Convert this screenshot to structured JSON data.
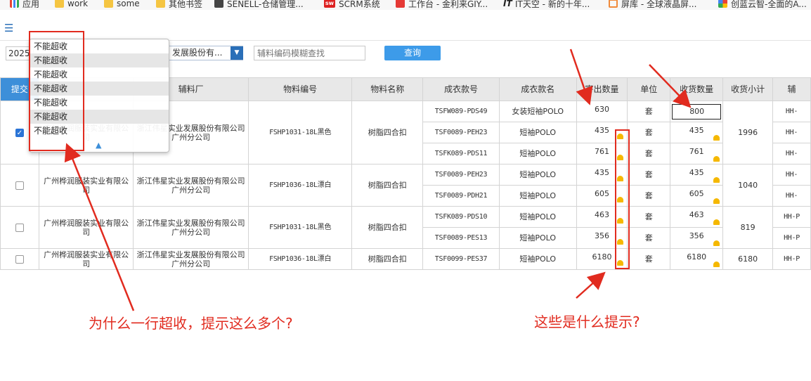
{
  "bookmarks": [
    {
      "label": "应用",
      "icon": "apps-grid-icon"
    },
    {
      "label": "work",
      "icon": "folder-icon"
    },
    {
      "label": "some",
      "icon": "folder-icon"
    },
    {
      "label": "其他书签",
      "icon": "folder-icon"
    },
    {
      "label": "SENELL-仓储管理...",
      "icon": "senell-icon"
    },
    {
      "label": "SCRM系统",
      "icon": "sw-icon"
    },
    {
      "label": "工作台 - 金利来GIY...",
      "icon": "red-square-icon"
    },
    {
      "label": "IT天空 - 新的十年...",
      "icon": "it-icon"
    },
    {
      "label": "屏库 - 全球液晶屏...",
      "icon": "orange-circle-icon"
    },
    {
      "label": "创蓝云智-全面的A...",
      "icon": "multicolor-icon"
    }
  ],
  "toolbar": {
    "year_value": "2025",
    "supplier_value": "发展股份有...",
    "search_placeholder": "辅料编码模糊查找",
    "query_label": "查询"
  },
  "dropdown": {
    "items": [
      "不能超收",
      "不能超收",
      "不能超收",
      "不能超收",
      "不能超收",
      "不能超收",
      "不能超收"
    ]
  },
  "table": {
    "headers": [
      "提交",
      "",
      "辅料厂",
      "物料编号",
      "物料名称",
      "成衣款号",
      "成衣款名",
      "寄出数量",
      "单位",
      "收货数量",
      "收货小计",
      "辅"
    ],
    "groups": [
      {
        "checked": true,
        "factory": "广州桦润服装实业有限公司",
        "supplier": "浙江伟星实业发展股份有限公司广州分公司",
        "material_no": "FSHP1031-18L黑色",
        "material_name": "树脂四合扣",
        "subtotal": "1996",
        "rows": [
          {
            "style_no": "TSFW089-PDS49",
            "style_name": "女装短袖POLO",
            "sent": "630",
            "unit": "套",
            "received": "800",
            "sent_warn": false,
            "recv_warn": false,
            "editing": true,
            "extra": "HH-"
          },
          {
            "style_no": "TSF0089-PEH23",
            "style_name": "短袖POLO",
            "sent": "435",
            "unit": "套",
            "received": "435",
            "sent_warn": true,
            "recv_warn": true,
            "editing": false,
            "extra": "HH-"
          },
          {
            "style_no": "TSFK089-PDS11",
            "style_name": "短袖POLO",
            "sent": "761",
            "unit": "套",
            "received": "761",
            "sent_warn": true,
            "recv_warn": true,
            "editing": false,
            "extra": "HH-"
          }
        ]
      },
      {
        "checked": false,
        "factory": "广州桦润服装实业有限公司",
        "supplier": "浙江伟星实业发展股份有限公司广州分公司",
        "material_no": "FSHP1036-18L漂白",
        "material_name": "树脂四合扣",
        "subtotal": "1040",
        "rows": [
          {
            "style_no": "TSF0089-PEH23",
            "style_name": "短袖POLO",
            "sent": "435",
            "unit": "套",
            "received": "435",
            "sent_warn": true,
            "recv_warn": true,
            "editing": false,
            "extra": "HH-"
          },
          {
            "style_no": "TSF0089-PDH21",
            "style_name": "短袖POLO",
            "sent": "605",
            "unit": "套",
            "received": "605",
            "sent_warn": true,
            "recv_warn": true,
            "editing": false,
            "extra": "HH-"
          }
        ]
      },
      {
        "checked": false,
        "factory": "广州桦润服装实业有限公司",
        "supplier": "浙江伟星实业发展股份有限公司广州分公司",
        "material_no": "FSHP1031-18L黑色",
        "material_name": "树脂四合扣",
        "subtotal": "819",
        "rows": [
          {
            "style_no": "TSFK089-PDS10",
            "style_name": "短袖POLO",
            "sent": "463",
            "unit": "套",
            "received": "463",
            "sent_warn": true,
            "recv_warn": true,
            "editing": false,
            "extra": "HH-P"
          },
          {
            "style_no": "TSF0089-PES13",
            "style_name": "短袖POLO",
            "sent": "356",
            "unit": "套",
            "received": "356",
            "sent_warn": true,
            "recv_warn": true,
            "editing": false,
            "extra": "HH-P"
          }
        ]
      },
      {
        "checked": false,
        "factory": "广州桦润服装实业有限公司",
        "supplier": "浙江伟星实业发展股份有限公司广州分公司",
        "material_no": "FSHP1036-18L漂白",
        "material_name": "树脂四合扣",
        "subtotal": "6180",
        "rows": [
          {
            "style_no": "TSF0099-PES37",
            "style_name": "短袖POLO",
            "sent": "6180",
            "unit": "套",
            "received": "6180",
            "sent_warn": true,
            "recv_warn": true,
            "editing": false,
            "extra": "HH-P"
          }
        ]
      }
    ]
  },
  "annotations": {
    "left_question": "为什么一行超收，提示这么多个?",
    "right_question": "这些是什么提示?"
  },
  "colors": {
    "accent": "#3d8fd9",
    "annotation_red": "#e12b1f",
    "warning": "#f5b800"
  }
}
